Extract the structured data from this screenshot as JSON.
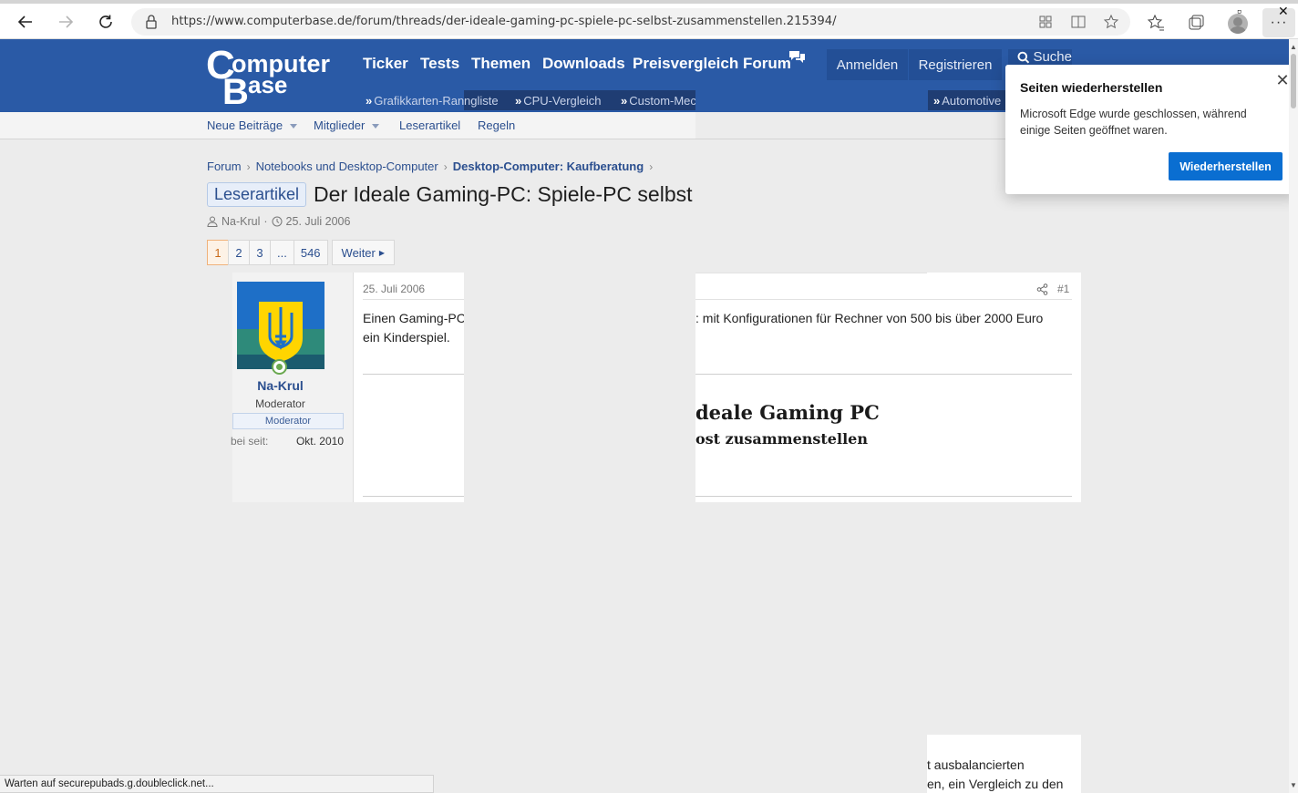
{
  "browser": {
    "url": "https://www.computerbase.de/forum/threads/der-ideale-gaming-pc-spiele-pc-selbst-zusammenstellen.215394/",
    "menu_label": "···",
    "status_text": "Warten auf securepubads.g.doubleclick.net..."
  },
  "site": {
    "logo_line1": "omputer",
    "logo_letter_c": "C",
    "logo_letter_b": "B",
    "logo_line2": "ase",
    "nav": [
      "Ticker",
      "Tests",
      "Themen",
      "Downloads",
      "Preisvergleich",
      "Forum"
    ],
    "login": "Anmelden",
    "register": "Registrieren",
    "search": "Suche",
    "subnav": [
      "Grafikkarten-Rangliste",
      "CPU-Vergleich",
      "Custom-Mec",
      "Automotive"
    ],
    "subnav_marker": "»"
  },
  "forum_nav": {
    "items": [
      "Neue Beiträge",
      "Mitglieder",
      "Leserartikel",
      "Regeln"
    ]
  },
  "breadcrumb": [
    "Forum",
    "Notebooks und Desktop-Computer",
    "Desktop-Computer: Kaufberatung"
  ],
  "thread": {
    "tag": "Leserartikel",
    "title": "Der Ideale Gaming-PC: Spiele-PC selbst",
    "author": "Na-Krul",
    "date": "25. Juli 2006"
  },
  "pager": {
    "pages": [
      "1",
      "2",
      "3",
      "...",
      "546"
    ],
    "next": "Weiter"
  },
  "post": {
    "username": "Na-Krul",
    "role": "Moderator",
    "badge": "Moderator",
    "since_label": "bei seit:",
    "since_value": "Okt. 2010",
    "date": "25. Juli 2006",
    "number": "#1",
    "text_a_line1": "Einen Gaming-PC",
    "text_a_line2": "ein Kinderspiel.",
    "text_b_line1": ": mit Konfigurationen für Rechner von 500 bis über 2000 Euro",
    "heading_1": "deale Gaming PC",
    "heading_2": "ost zusammenstellen",
    "bottom_line1": "t ausbalancierten",
    "bottom_line2": "en, ein Vergleich zu den"
  },
  "popup": {
    "title": "Seiten wiederherstellen",
    "text": "Microsoft Edge wurde geschlossen, während einige Seiten geöffnet waren.",
    "button": "Wiederherstellen",
    "close": "✕"
  },
  "colors": {
    "header_blue": "#2a5aa6",
    "link_blue": "#2b4f8f",
    "edge_button": "#0a6ed1"
  }
}
